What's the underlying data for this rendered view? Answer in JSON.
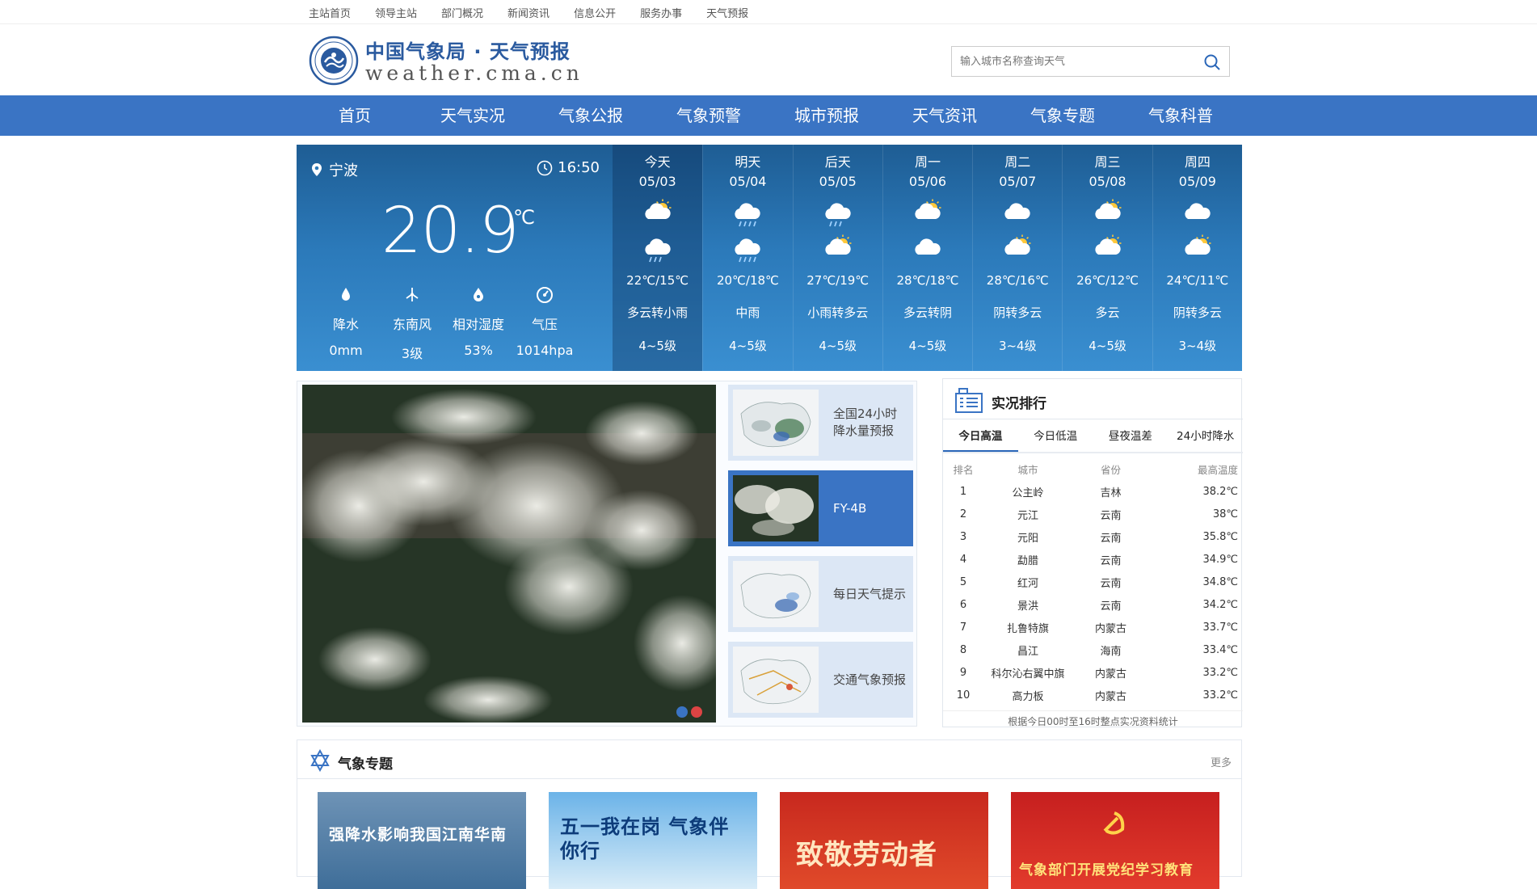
{
  "topbar": {
    "links": [
      "主站首页",
      "领导主站",
      "部门概况",
      "新闻资讯",
      "信息公开",
      "服务办事",
      "天气预报"
    ]
  },
  "header": {
    "title": "中国气象局 · 天气预报",
    "subtitle": "weather.cma.cn",
    "search_placeholder": "输入城市名称查询天气"
  },
  "nav": {
    "items": [
      "首页",
      "天气实况",
      "气象公报",
      "气象预警",
      "城市预报",
      "天气资讯",
      "气象专题",
      "气象科普"
    ]
  },
  "current": {
    "city": "宁波",
    "time": "16:50",
    "temp": "20.9",
    "unit": "℃",
    "metrics": [
      {
        "icon": "drop-icon",
        "label": "降水",
        "value": "0mm"
      },
      {
        "icon": "wind-icon",
        "label": "东南风",
        "value": "3级"
      },
      {
        "icon": "humidity-icon",
        "label": "相对湿度",
        "value": "53%"
      },
      {
        "icon": "gauge-icon",
        "label": "气压",
        "value": "1014hpa"
      }
    ]
  },
  "forecast": [
    {
      "name": "今天",
      "date": "05/03",
      "icon_day": "partly-cloudy",
      "icon_night": "light-rain",
      "temp": "22℃/15℃",
      "weather": "多云转小雨",
      "wind": "4~5级",
      "today": true
    },
    {
      "name": "明天",
      "date": "05/04",
      "icon_day": "moderate-rain",
      "icon_night": "moderate-rain",
      "temp": "20℃/18℃",
      "weather": "中雨",
      "wind": "4~5级"
    },
    {
      "name": "后天",
      "date": "05/05",
      "icon_day": "light-rain",
      "icon_night": "partly-cloudy",
      "temp": "27℃/19℃",
      "weather": "小雨转多云",
      "wind": "4~5级"
    },
    {
      "name": "周一",
      "date": "05/06",
      "icon_day": "partly-cloudy",
      "icon_night": "overcast",
      "temp": "28℃/18℃",
      "weather": "多云转阴",
      "wind": "4~5级"
    },
    {
      "name": "周二",
      "date": "05/07",
      "icon_day": "overcast",
      "icon_night": "partly-cloudy",
      "temp": "28℃/16℃",
      "weather": "阴转多云",
      "wind": "3~4级"
    },
    {
      "name": "周三",
      "date": "05/08",
      "icon_day": "partly-cloudy",
      "icon_night": "partly-cloudy",
      "temp": "26℃/12℃",
      "weather": "多云",
      "wind": "4~5级"
    },
    {
      "name": "周四",
      "date": "05/09",
      "icon_day": "overcast",
      "icon_night": "partly-cloudy",
      "temp": "24℃/11℃",
      "weather": "阴转多云",
      "wind": "3~4级"
    }
  ],
  "products": [
    {
      "label": "全国24小时降水量预报"
    },
    {
      "label": "FY-4B",
      "active": true
    },
    {
      "label": "每日天气提示"
    },
    {
      "label": "交通气象预报"
    }
  ],
  "rank": {
    "title": "实况排行",
    "tabs": [
      "今日高温",
      "今日低温",
      "昼夜温差",
      "24小时降水"
    ],
    "headers": [
      "排名",
      "城市",
      "省份",
      "最高温度"
    ],
    "rows": [
      [
        "1",
        "公主岭",
        "吉林",
        "38.2℃"
      ],
      [
        "2",
        "元江",
        "云南",
        "38℃"
      ],
      [
        "3",
        "元阳",
        "云南",
        "35.8℃"
      ],
      [
        "4",
        "勐腊",
        "云南",
        "34.9℃"
      ],
      [
        "5",
        "红河",
        "云南",
        "34.8℃"
      ],
      [
        "6",
        "景洪",
        "云南",
        "34.2℃"
      ],
      [
        "7",
        "扎鲁特旗",
        "内蒙古",
        "33.7℃"
      ],
      [
        "8",
        "昌江",
        "海南",
        "33.4℃"
      ],
      [
        "9",
        "科尔沁右翼中旗",
        "内蒙古",
        "33.2℃"
      ],
      [
        "10",
        "高力板",
        "内蒙古",
        "33.2℃"
      ]
    ],
    "footnote": "根据今日00时至16时整点实况资料统计"
  },
  "topics": {
    "title": "气象专题",
    "more": "更多",
    "cards": [
      {
        "label": "强降水影响我国江南华南",
        "color": "#ffffff"
      },
      {
        "label": "五一我在岗 气象伴你行",
        "color": "#0d3c7a"
      },
      {
        "label": "致敬劳动者",
        "color": "#ffe6c0"
      },
      {
        "label": "气象部门开展党纪学习教育",
        "color": "#ffe27a"
      }
    ]
  }
}
